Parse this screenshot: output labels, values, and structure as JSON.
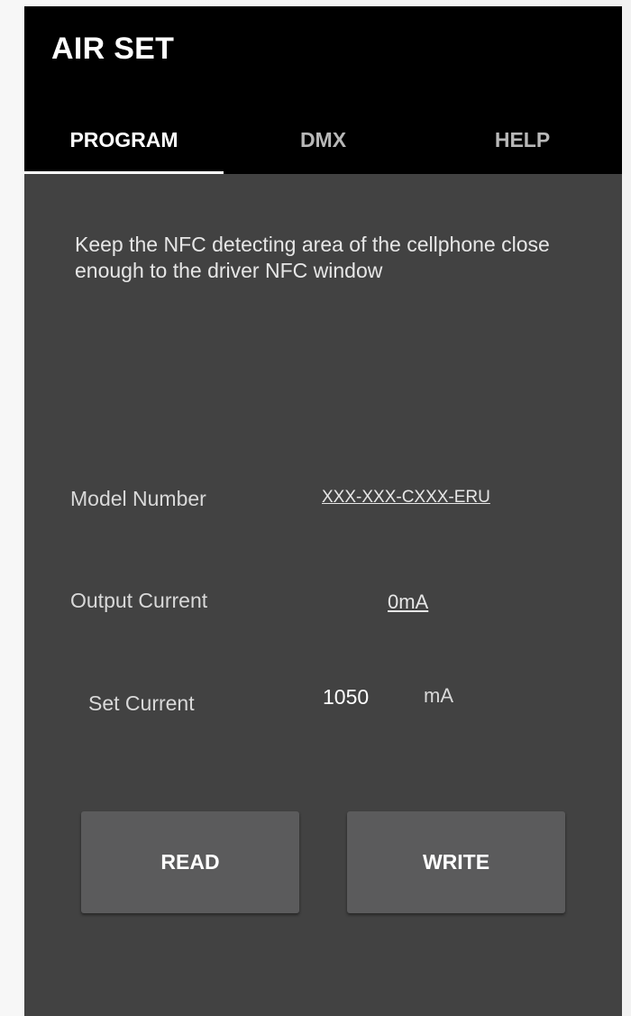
{
  "app": {
    "title": "AIR SET"
  },
  "tabs": [
    {
      "label": "PROGRAM",
      "active": true
    },
    {
      "label": "DMX",
      "active": false
    },
    {
      "label": "HELP",
      "active": false
    }
  ],
  "program": {
    "instruction": "Keep the NFC detecting area of the cellphone close enough to the driver NFC window",
    "model_number": {
      "label": "Model Number",
      "value": "XXX-XXX-CXXX-ERU"
    },
    "output_current": {
      "label": "Output Current",
      "value": "0mA"
    },
    "set_current": {
      "label": "Set Current",
      "value": "1050",
      "unit": "mA"
    },
    "buttons": {
      "read": "READ",
      "write": "WRITE"
    }
  },
  "colors": {
    "app_bar": "#000000",
    "content_bg": "#424242",
    "button_bg": "#5b5b5c",
    "text_primary": "#ffffff"
  }
}
